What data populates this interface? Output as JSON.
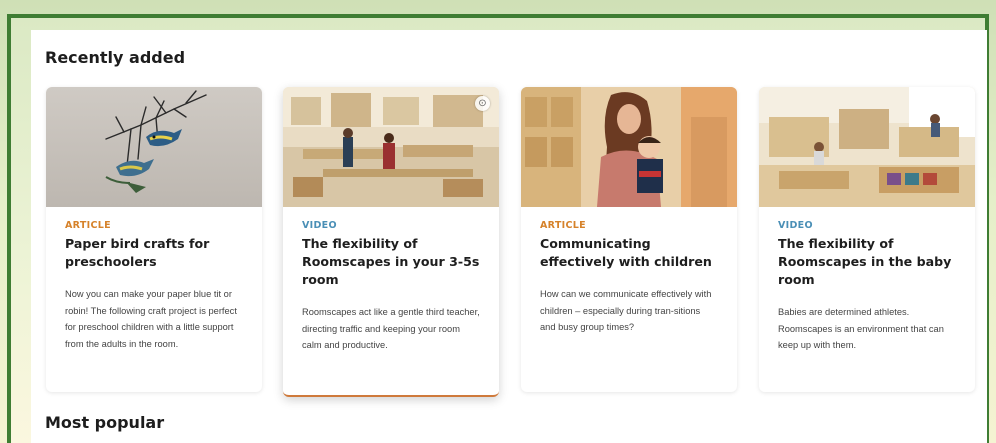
{
  "sections": {
    "recent_title": "Recently added",
    "popular_title": "Most popular"
  },
  "cards": [
    {
      "type": "ARTICLE",
      "title": "Paper bird crafts for preschoolers",
      "description": "Now you can make your paper blue tit or robin! The following craft project is perfect for preschool children with a little support from the adults in the room.",
      "thumbnail": "paper-birds-mobile-image"
    },
    {
      "type": "VIDEO",
      "title": "The flexibility of Roomscapes in your 3-5s room",
      "description": "Roomscapes act like a gentle third teacher, directing traffic and keeping your room calm and productive.",
      "thumbnail": "classroom-3-5s-image"
    },
    {
      "type": "ARTICLE",
      "title": "Communicating effectively with children",
      "description": "How can we communicate effectively with children – especially during tran-sitions and busy group times?",
      "thumbnail": "teacher-with-child-image"
    },
    {
      "type": "VIDEO",
      "title": "The flexibility of Roomscapes in the baby room",
      "description": "Babies are determined athletes. Roomscapes is an environment that can keep up with them.",
      "thumbnail": "baby-room-image"
    }
  ],
  "colors": {
    "frame_green": "#3f7d33",
    "article_label": "#d6822a",
    "video_label": "#4a8fb6",
    "hover_underline": "#cf7a3b"
  }
}
